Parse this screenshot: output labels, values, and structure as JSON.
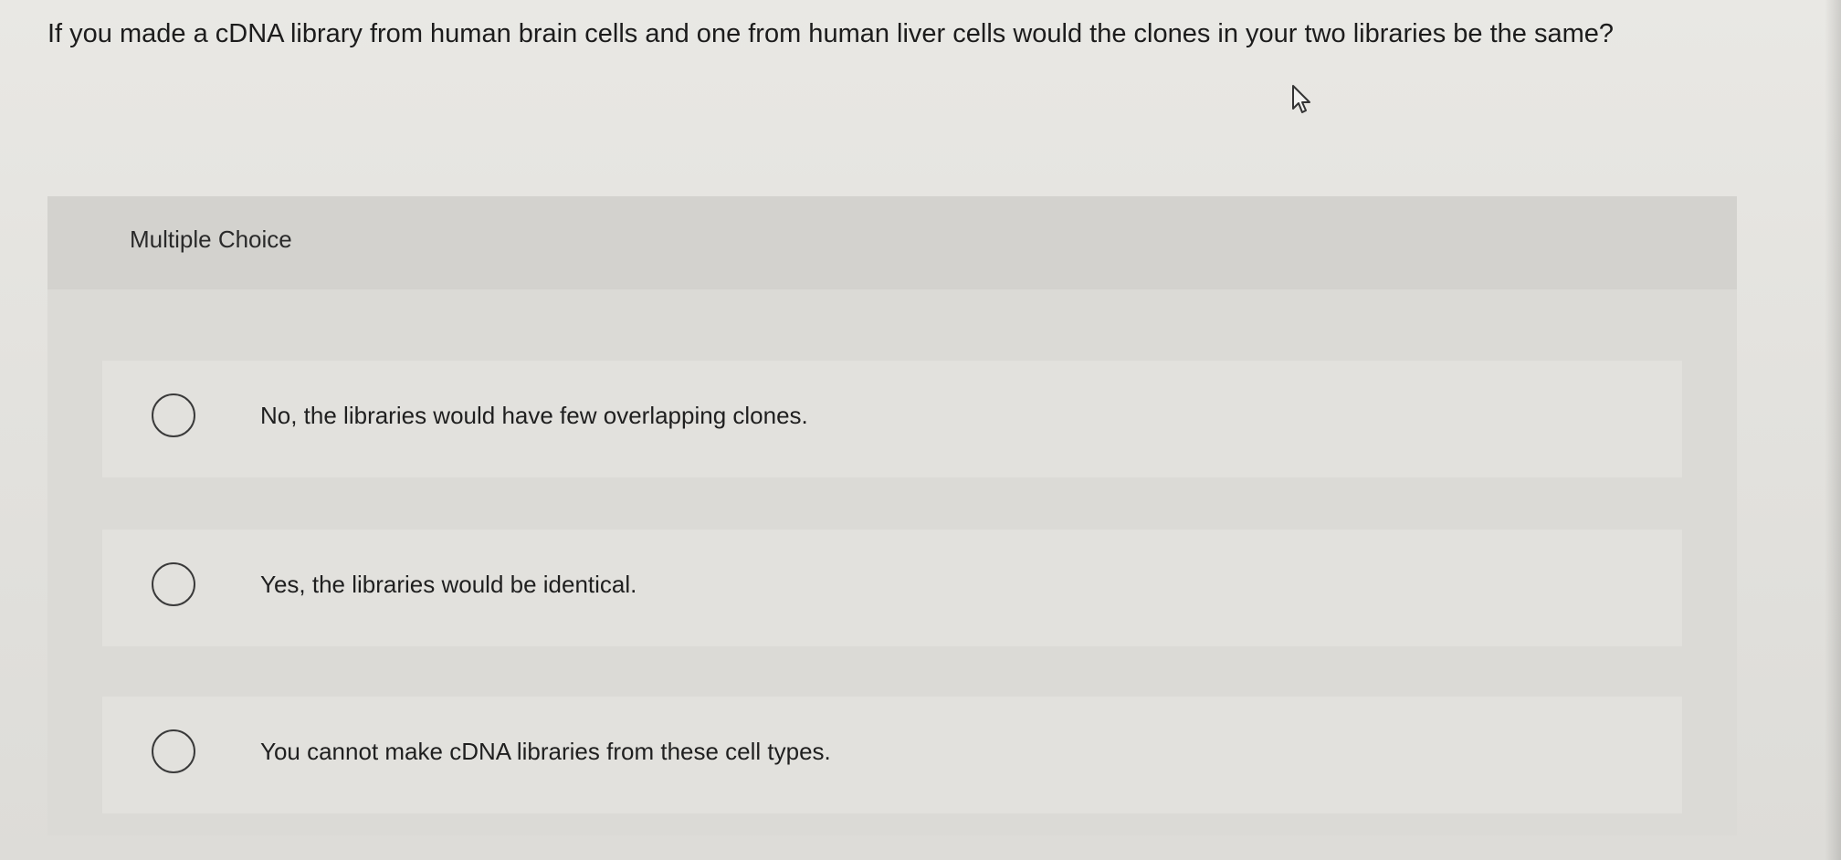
{
  "question": {
    "text": "If you made a cDNA library from human brain cells and one from human liver cells would the clones in your two libraries be the same?"
  },
  "multiple_choice": {
    "header": "Multiple Choice",
    "options": [
      {
        "label": "No, the libraries would have few overlapping clones."
      },
      {
        "label": "Yes, the libraries would be identical."
      },
      {
        "label": "You cannot make cDNA libraries from these cell types."
      }
    ]
  },
  "icons": {
    "cursor": "mouse-pointer-icon",
    "radio": "radio-unchecked-icon"
  }
}
